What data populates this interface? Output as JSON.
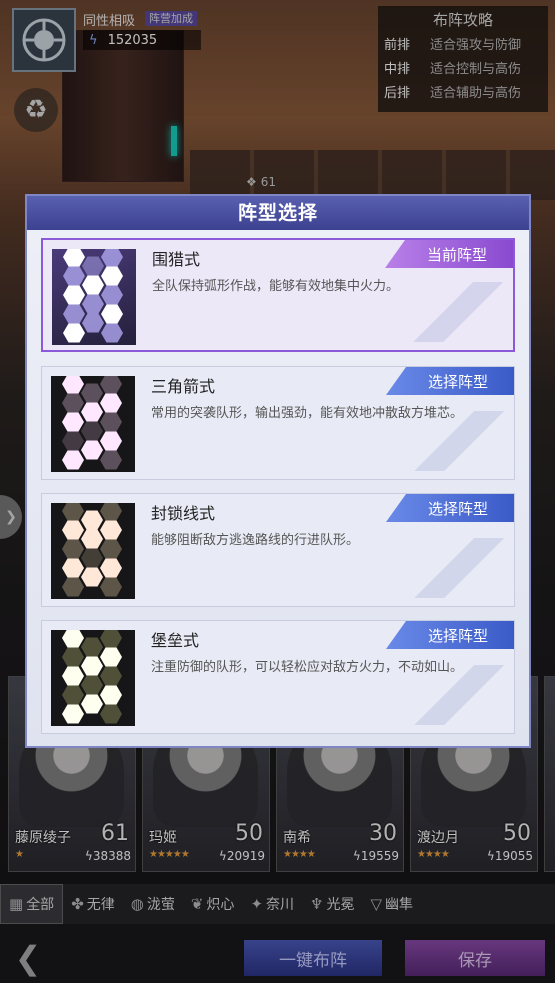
{
  "background": {
    "team_name": "同性相吸",
    "team_badge": "阵营加成",
    "power": "152035",
    "unit_count": "61",
    "strategy": {
      "title": "布阵攻略",
      "rows": [
        {
          "pos": "前排",
          "desc": "适合强攻与防御"
        },
        {
          "pos": "中排",
          "desc": "适合控制与高伤"
        },
        {
          "pos": "后排",
          "desc": "适合辅助与高伤"
        }
      ]
    }
  },
  "modal": {
    "title": "阵型选择",
    "options": [
      {
        "name": "围猎式",
        "desc": "全队保持弧形作战，能够有效地集中火力。",
        "tag": "当前阵型",
        "current": true,
        "colors": [
          "#ffffff",
          "#d8d8ff",
          "#a8a0e8"
        ]
      },
      {
        "name": "三角箭式",
        "desc": "常用的突袭队形，输出强劲，能有效地冲散敌方堆芯。",
        "tag": "选择阵型",
        "current": false,
        "colors": [
          "#ffe8ff",
          "#f8d0f0",
          "#6a5a6a"
        ]
      },
      {
        "name": "封锁线式",
        "desc": "能够阻断敌方逃逸路线的行进队形。",
        "tag": "选择阵型",
        "current": false,
        "colors": [
          "#ffe8d8",
          "#f0c8a8",
          "#6a6050"
        ]
      },
      {
        "name": "堡垒式",
        "desc": "注重防御的队形，可以轻松应对敌方火力，不动如山。",
        "tag": "选择阵型",
        "current": false,
        "colors": [
          "#fffff0",
          "#f0f0c8",
          "#5a5a40"
        ]
      }
    ]
  },
  "cards": [
    {
      "name": "藤原绫子",
      "level": "61",
      "power": "38388",
      "stars": "★"
    },
    {
      "name": "玛姬",
      "level": "50",
      "power": "20919",
      "stars": "★★★★★"
    },
    {
      "name": "南希",
      "level": "30",
      "power": "19559",
      "stars": "★★★★"
    },
    {
      "name": "渡边月",
      "level": "50",
      "power": "19055",
      "stars": "★★★★"
    }
  ],
  "filters": [
    {
      "label": "全部",
      "icon": "grid-icon",
      "glyph": "▦"
    },
    {
      "label": "无律",
      "icon": "chaos-icon",
      "glyph": "✤"
    },
    {
      "label": "泷萤",
      "icon": "swirl-icon",
      "glyph": "◍"
    },
    {
      "label": "炽心",
      "icon": "flame-icon",
      "glyph": "❦"
    },
    {
      "label": "奈川",
      "icon": "compass-icon",
      "glyph": "✦"
    },
    {
      "label": "光冕",
      "icon": "crown-icon",
      "glyph": "♆"
    },
    {
      "label": "幽隼",
      "icon": "falcon-icon",
      "glyph": "▽"
    }
  ],
  "actions": {
    "auto": "一键布阵",
    "save": "保存"
  }
}
